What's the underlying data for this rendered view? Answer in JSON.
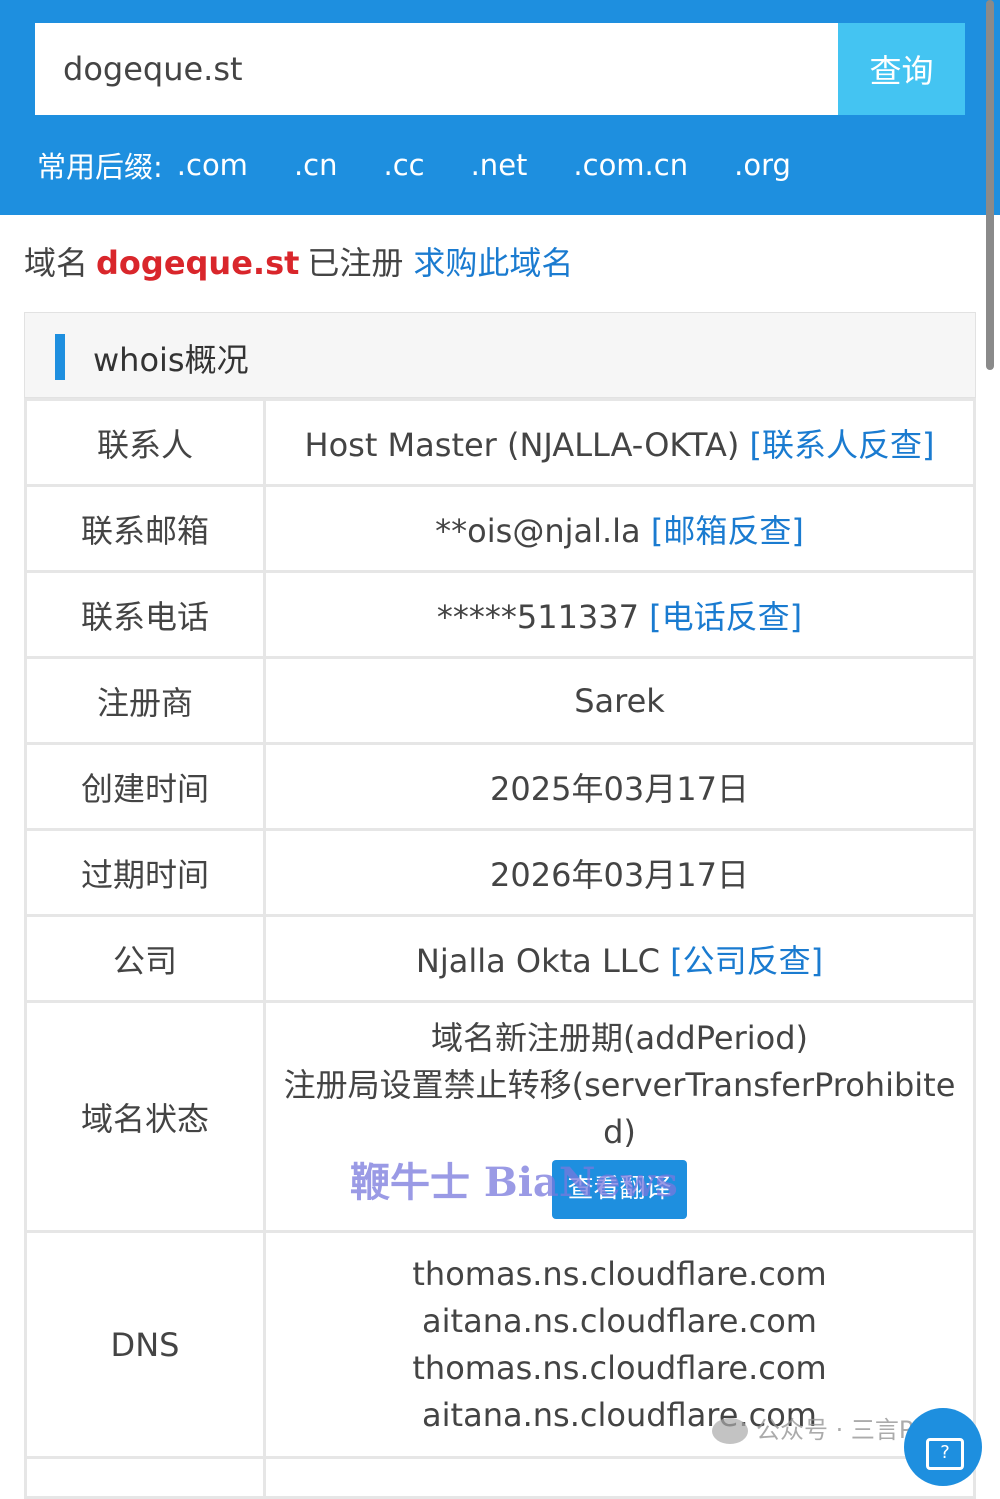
{
  "search": {
    "value": "dogeque.st",
    "button_label": "查询",
    "suffix_label": "常用后缀:",
    "suffixes": [
      ".com",
      ".cn",
      ".cc",
      ".net",
      ".com.cn",
      ".org"
    ]
  },
  "result": {
    "prefix": "域名",
    "domain": "dogeque.st",
    "status_text": "已注册",
    "buy_link": "求购此域名"
  },
  "whois": {
    "title": "whois概况",
    "rows": [
      {
        "label": "联系人",
        "value": "Host Master (NJALLA-OKTA)",
        "link": "[联系人反查]"
      },
      {
        "label": "联系邮箱",
        "value": "**ois@njal.la",
        "link": "[邮箱反查]"
      },
      {
        "label": "联系电话",
        "value": "*****511337",
        "link": "[电话反查]"
      },
      {
        "label": "注册商",
        "value": "Sarek"
      },
      {
        "label": "创建时间",
        "value": "2025年03月17日"
      },
      {
        "label": "过期时间",
        "value": "2026年03月17日"
      },
      {
        "label": "公司",
        "value": "Njalla Okta LLC",
        "link": "[公司反查]"
      }
    ],
    "status_row": {
      "label": "域名状态",
      "lines": [
        "域名新注册期(addPeriod)",
        "注册局设置禁止转移(serverTransferProhibite",
        "d)"
      ],
      "translate_button": "查看翻译"
    },
    "dns_row": {
      "label": "DNS",
      "lines": [
        "thomas.ns.cloudflare.com",
        "aitana.ns.cloudflare.com",
        "thomas.ns.cloudflare.com",
        "aitana.ns.cloudflare.com"
      ]
    }
  },
  "overlay": {
    "watermark": "鞭牛士 BiaNews",
    "wechat": "公众号 · 三言Pro"
  },
  "colors": {
    "primary": "#1e8fdf",
    "search_button": "#44c4f2",
    "domain_highlight": "#d9262b",
    "link": "#1a7bd0"
  },
  "icons": {
    "help": "help-chat-icon",
    "wechat": "wechat-logo-icon"
  }
}
